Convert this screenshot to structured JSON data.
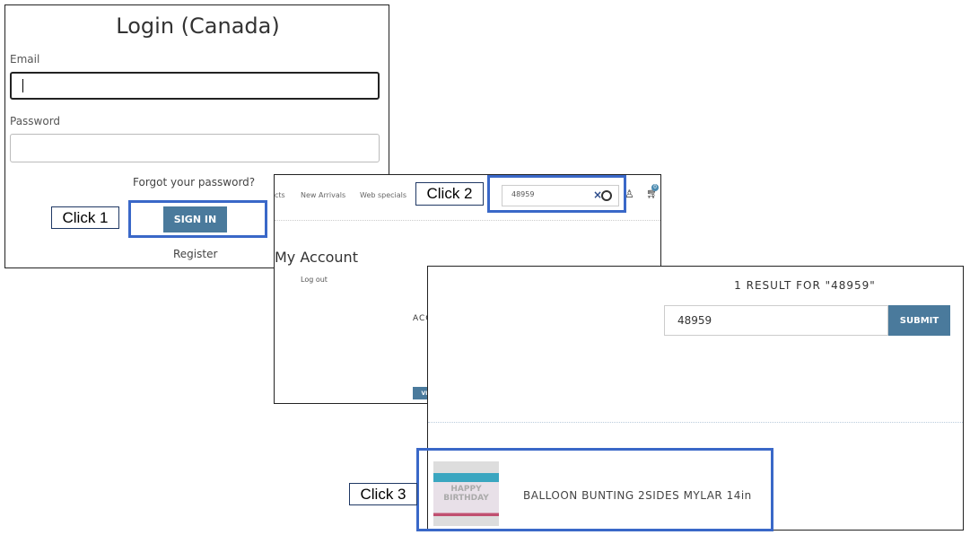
{
  "login": {
    "title": "Login (Canada)",
    "email_label": "Email",
    "email_value": "",
    "password_label": "Password",
    "forgot": "Forgot your password?",
    "sign_in": "SIGN IN",
    "register": "Register"
  },
  "account": {
    "nav": [
      "cts",
      "New Arrivals",
      "Web specials"
    ],
    "search_value": "48959",
    "clear": "×",
    "title": "My Account",
    "logout": "Log out",
    "partial_heading": "ACC",
    "partial_button": "VIE",
    "cart_count": "0"
  },
  "results": {
    "title": "1 RESULT FOR \"48959\"",
    "search_value": "48959",
    "submit": "SUBMIT",
    "product_name": "BALLOON BUNTING 2SIDES MYLAR 14in",
    "product_image_text": "HAPPY BIRTHDAY"
  },
  "callouts": {
    "click1": "Click 1",
    "click2": "Click 2",
    "click3": "Click 3"
  },
  "colors": {
    "highlight": "#3a68c8",
    "button": "#4a7a9c"
  }
}
